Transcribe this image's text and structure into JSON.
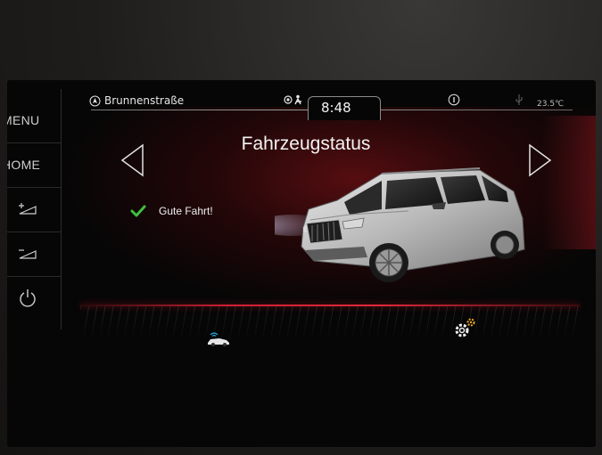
{
  "side_menu": {
    "menu_label": "MENU",
    "home_label": "HOME",
    "volume_up_icon": "volume-up-icon",
    "volume_down_icon": "volume-down-icon",
    "power_icon": "power-icon"
  },
  "statusbar": {
    "street": "Brunnenstraße",
    "time": "8:48",
    "temperature": "23.5℃",
    "icons": [
      "navigation-icon",
      "traffic-icon",
      "info-icon",
      "usb-icon"
    ]
  },
  "main": {
    "title": "Fahrzeugstatus",
    "status_text": "Gute Fahrt!",
    "status_icon": "checkmark-icon",
    "prev_icon": "arrow-left-icon",
    "next_icon": "arrow-right-icon"
  },
  "bottom_tabs": [
    {
      "icon": "car-connect-icon"
    },
    {
      "icon": "settings-gears-icon"
    }
  ],
  "colors": {
    "accent_red": "#d02033",
    "check_green": "#3fbf3f",
    "text": "#f0f0f0"
  }
}
